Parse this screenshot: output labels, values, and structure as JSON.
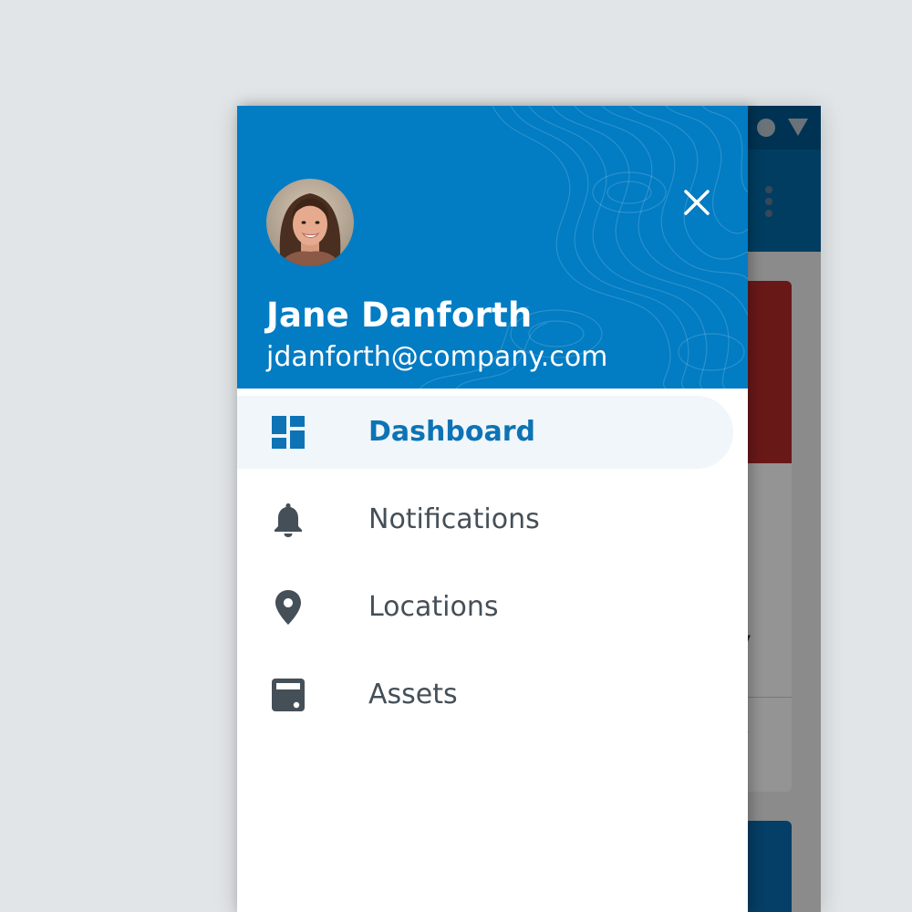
{
  "background_app": {
    "card_text_fragment": "y"
  },
  "drawer": {
    "user": {
      "name": "Jane Danforth",
      "email": "jdanforth@company.com"
    },
    "nav": [
      {
        "label": "Dashboard",
        "icon": "dashboard-icon",
        "active": true
      },
      {
        "label": "Notifications",
        "icon": "bell-icon",
        "active": false
      },
      {
        "label": "Locations",
        "icon": "location-pin-icon",
        "active": false
      },
      {
        "label": "Assets",
        "icon": "assets-icon",
        "active": false
      }
    ]
  },
  "colors": {
    "header_blue": "#027cc3",
    "active_text": "#0d73b5",
    "active_bg": "#f0f6fa",
    "inactive_text": "#454f58",
    "icon_gray": "#454f58"
  }
}
